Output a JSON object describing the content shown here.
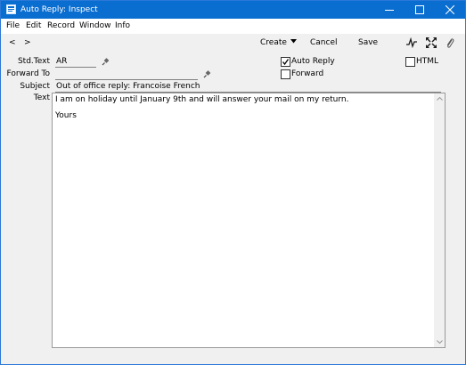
{
  "window": {
    "title": "Auto Reply: Inspect"
  },
  "menu": [
    "File",
    "Edit",
    "Record",
    "Window",
    "Info"
  ],
  "toolbar": {
    "back_symbol": "<",
    "forward_symbol": ">",
    "create_label": "Create",
    "cancel_label": "Cancel",
    "save_label": "Save",
    "icons": [
      "back-arrow",
      "forward-arrow",
      "pulse-icon",
      "expand-icon",
      "paperclip-icon"
    ]
  },
  "form": {
    "std_text_label": "Std.Text",
    "std_text_value": "AR",
    "forward_to_label": "Forward To",
    "forward_to_value": "",
    "subject_label": "Subject",
    "subject_value": "Out of office reply: Francoise French",
    "text_label": "Text",
    "text_lines": [
      "I am on holiday until January 9th and will answer your mail on my return.",
      "",
      "Yours"
    ],
    "auto_reply": {
      "label": "Auto Reply",
      "checked": true
    },
    "forward": {
      "label": "Forward",
      "checked": false
    },
    "html": {
      "label": "HTML",
      "checked": false
    }
  },
  "colors": {
    "titlebar": "#0a6ed1",
    "window_bg": "#f0f0f0"
  }
}
